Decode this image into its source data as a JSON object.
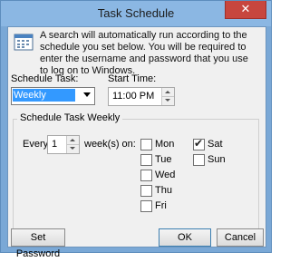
{
  "window": {
    "title": "Task Schedule",
    "close_glyph": "✕"
  },
  "info": {
    "icon": "calendar-icon",
    "text": "A search will automatically run according to the schedule you set below.  You will be required to enter the username and password that you use to log on to Windows."
  },
  "schedule_task": {
    "label": "Schedule Task:",
    "selected": "Weekly"
  },
  "start_time": {
    "label": "Start Time:",
    "value": "11:00 PM"
  },
  "weekly_group": {
    "title": "Schedule Task Weekly",
    "every_label": "Every",
    "every_value": "1",
    "weeks_on_label": "week(s) on:",
    "days": [
      {
        "label": "Mon",
        "checked": false
      },
      {
        "label": "Tue",
        "checked": false
      },
      {
        "label": "Wed",
        "checked": false
      },
      {
        "label": "Thu",
        "checked": false
      },
      {
        "label": "Fri",
        "checked": false
      },
      {
        "label": "Sat",
        "checked": true
      },
      {
        "label": "Sun",
        "checked": false
      }
    ]
  },
  "buttons": {
    "set_password": "Set Password",
    "ok": "OK",
    "cancel": "Cancel"
  },
  "colors": {
    "title_bar": "#8bb7e3",
    "close_button": "#c7463e",
    "selection": "#3399ff"
  }
}
